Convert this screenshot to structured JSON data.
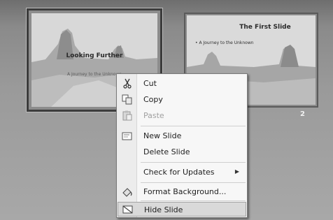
{
  "slides": [
    {
      "title": "Looking Further",
      "subtitle": "A Journey to the Unknown"
    },
    {
      "title": "The First Slide",
      "bullet": "A Journey to the Unknown",
      "number": "2"
    }
  ],
  "context_menu": {
    "items": [
      {
        "label": "Cut",
        "icon": "scissors-icon",
        "enabled": true
      },
      {
        "label": "Copy",
        "icon": "copy-icon",
        "enabled": true
      },
      {
        "label": "Paste",
        "icon": "paste-icon",
        "enabled": false
      },
      {
        "label": "New Slide",
        "icon": "new-slide-icon",
        "enabled": true
      },
      {
        "label": "Delete Slide",
        "enabled": true
      },
      {
        "label": "Check for Updates",
        "has_submenu": true,
        "enabled": true
      },
      {
        "label": "Format Background...",
        "icon": "format-background-icon",
        "enabled": true
      },
      {
        "label": "Hide Slide",
        "icon": "hide-slide-icon",
        "enabled": true,
        "highlighted": true
      }
    ]
  }
}
